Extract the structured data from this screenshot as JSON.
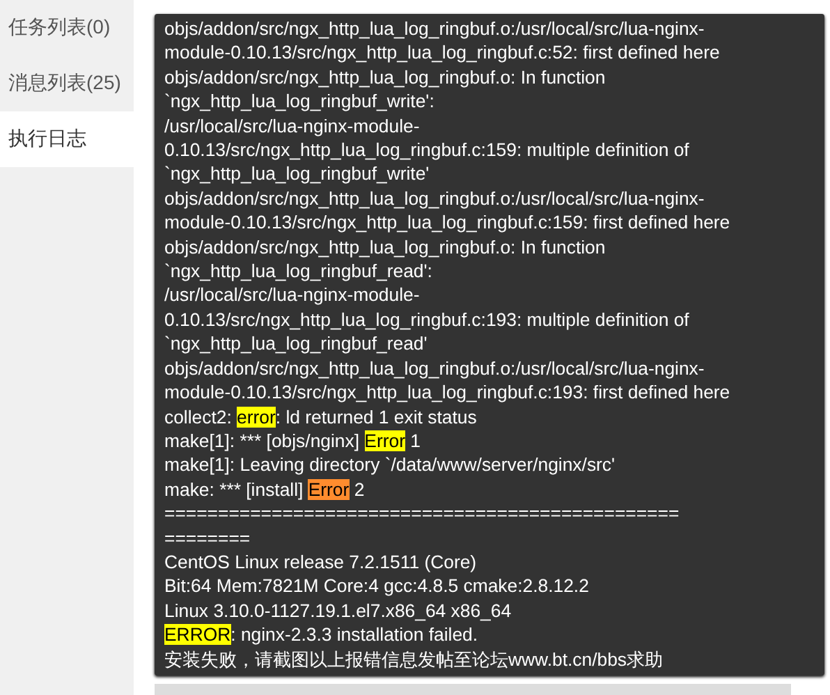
{
  "sidebar": {
    "items": [
      {
        "label": "任务列表(0)",
        "selected": false
      },
      {
        "label": "消息列表(25)",
        "selected": false
      },
      {
        "label": "执行日志",
        "selected": true
      }
    ]
  },
  "log": {
    "lines": [
      [
        {
          "text": "objs/addon/src/ngx_http_lua_log_ringbuf.o:/usr/local/src/lua-nginx-"
        }
      ],
      [
        {
          "text": "module-0.10.13/src/ngx_http_lua_log_ringbuf.c:52: first defined here"
        }
      ],
      [
        {
          "text": "objs/addon/src/ngx_http_lua_log_ringbuf.o: In function"
        }
      ],
      [
        {
          "text": "`ngx_http_lua_log_ringbuf_write':"
        }
      ],
      [
        {
          "text": "/usr/local/src/lua-nginx-module-"
        }
      ],
      [
        {
          "text": "0.10.13/src/ngx_http_lua_log_ringbuf.c:159: multiple definition of"
        }
      ],
      [
        {
          "text": "`ngx_http_lua_log_ringbuf_write'"
        }
      ],
      [
        {
          "text": "objs/addon/src/ngx_http_lua_log_ringbuf.o:/usr/local/src/lua-nginx-"
        }
      ],
      [
        {
          "text": "module-0.10.13/src/ngx_http_lua_log_ringbuf.c:159: first defined here"
        }
      ],
      [
        {
          "text": "objs/addon/src/ngx_http_lua_log_ringbuf.o: In function"
        }
      ],
      [
        {
          "text": "`ngx_http_lua_log_ringbuf_read':"
        }
      ],
      [
        {
          "text": "/usr/local/src/lua-nginx-module-"
        }
      ],
      [
        {
          "text": "0.10.13/src/ngx_http_lua_log_ringbuf.c:193: multiple definition of"
        }
      ],
      [
        {
          "text": "`ngx_http_lua_log_ringbuf_read'"
        }
      ],
      [
        {
          "text": "objs/addon/src/ngx_http_lua_log_ringbuf.o:/usr/local/src/lua-nginx-"
        }
      ],
      [
        {
          "text": "module-0.10.13/src/ngx_http_lua_log_ringbuf.c:193: first defined here"
        }
      ],
      [
        {
          "text": "collect2: "
        },
        {
          "text": "error",
          "color": "#ffff00"
        },
        {
          "text": ": ld returned 1 exit status"
        }
      ],
      [
        {
          "text": "make[1]: *** [objs/nginx] "
        },
        {
          "text": "Error",
          "color": "#ffff00"
        },
        {
          "text": " 1"
        }
      ],
      [
        {
          "text": "make[1]: Leaving directory `/data/www/server/nginx/src'"
        }
      ],
      [
        {
          "text": "make: *** [install] "
        },
        {
          "text": "Error",
          "color": "#ff8c2e"
        },
        {
          "text": " 2"
        }
      ],
      [
        {
          "text": "================================================"
        }
      ],
      [
        {
          "text": "========"
        }
      ],
      [
        {
          "text": "CentOS Linux release 7.2.1511 (Core)"
        }
      ],
      [
        {
          "text": "Bit:64 Mem:7821M Core:4 gcc:4.8.5 cmake:2.8.12.2"
        }
      ],
      [
        {
          "text": "Linux 3.10.0-1127.19.1.el7.x86_64 x86_64"
        }
      ],
      [
        {
          "text": "ERROR",
          "color": "#ffff00"
        },
        {
          "text": ": nginx-2.3.3 installation failed."
        }
      ],
      [
        {
          "text": "安装失败，请截图以上报错信息发帖至论坛www.bt.cn/bbs求助"
        }
      ]
    ]
  }
}
